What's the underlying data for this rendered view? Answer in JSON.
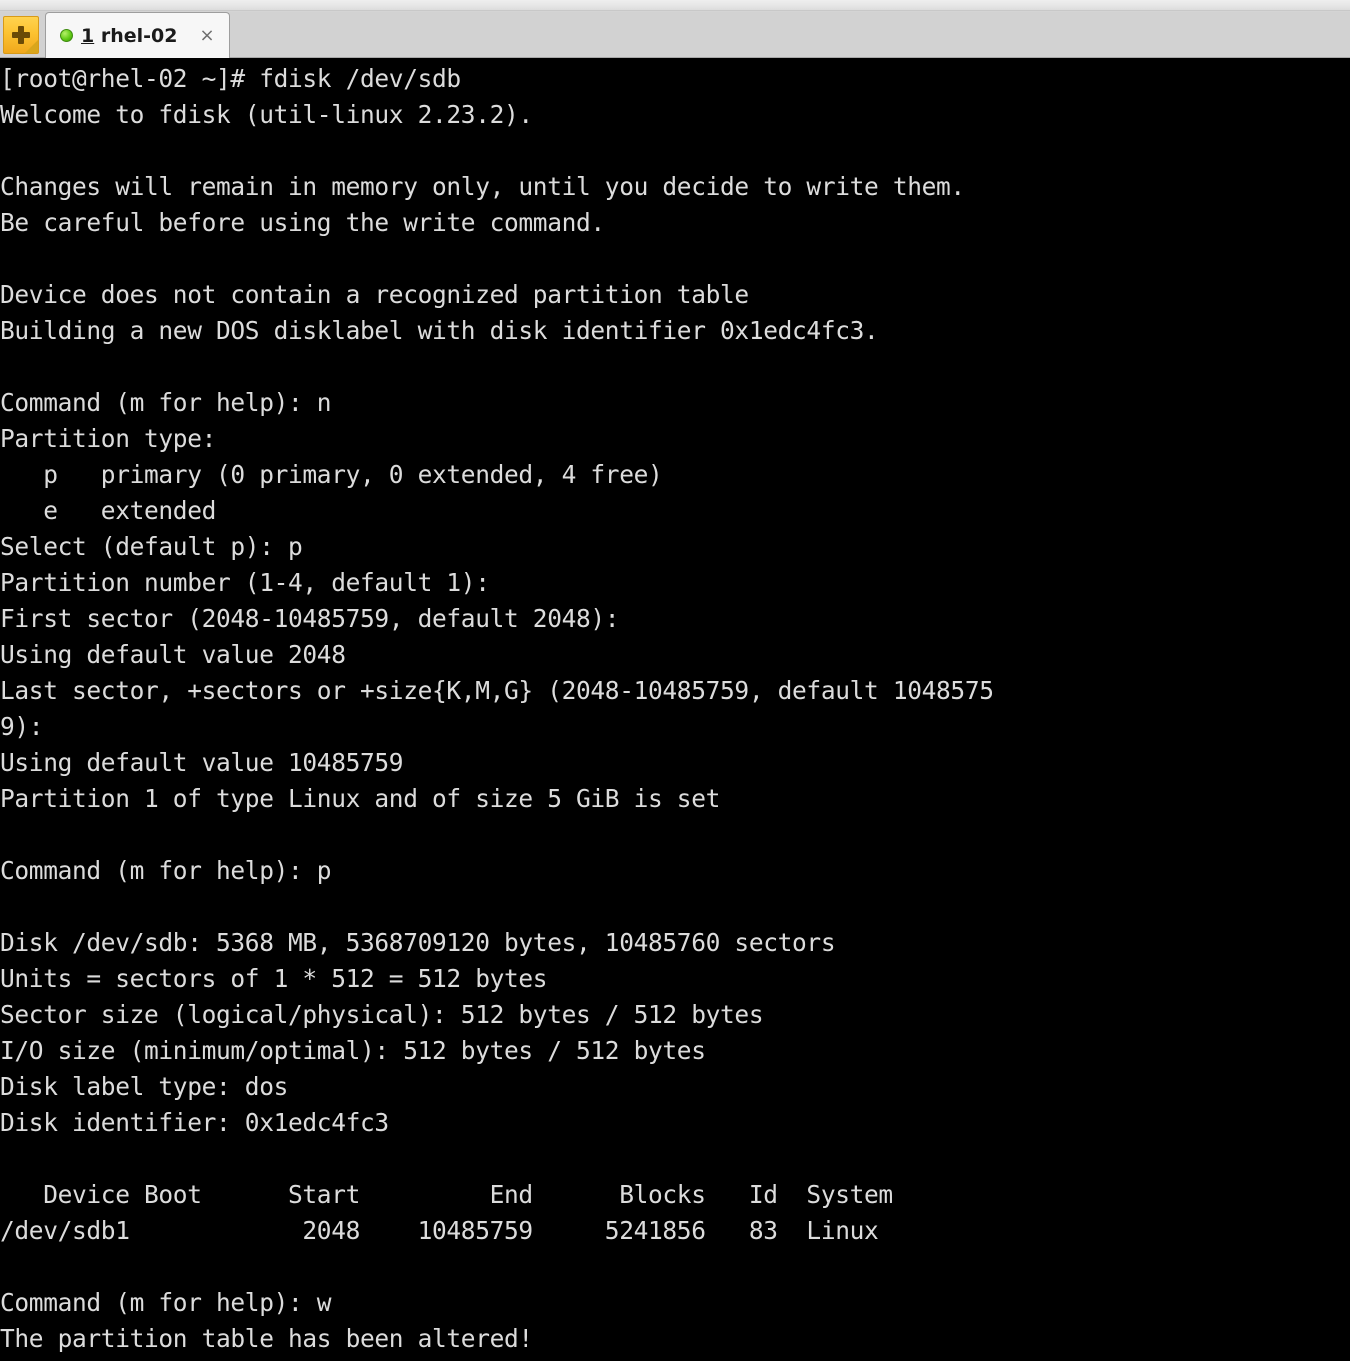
{
  "window": {
    "new_tab_button_label": "+",
    "tabs": [
      {
        "index": "1",
        "title": " rhel-02",
        "close_label": "×",
        "status": "connected",
        "active": true
      }
    ]
  },
  "terminal": {
    "hostname": "rhel-02",
    "user": "root",
    "prompt": "[root@rhel-02 ~]#",
    "colors": {
      "background": "#000000",
      "foreground": "#dcdcdc",
      "tab_bar": "#d2d2d2",
      "active_tab": "#f7f7f7",
      "status_dot": "#63cc17",
      "new_tab_button": "#fcc231"
    },
    "lines": [
      "[root@rhel-02 ~]# fdisk /dev/sdb",
      "Welcome to fdisk (util-linux 2.23.2).",
      "",
      "Changes will remain in memory only, until you decide to write them.",
      "Be careful before using the write command.",
      "",
      "Device does not contain a recognized partition table",
      "Building a new DOS disklabel with disk identifier 0x1edc4fc3.",
      "",
      "Command (m for help): n",
      "Partition type:",
      "   p   primary (0 primary, 0 extended, 4 free)",
      "   e   extended",
      "Select (default p): p",
      "Partition number (1-4, default 1):",
      "First sector (2048-10485759, default 2048):",
      "Using default value 2048",
      "Last sector, +sectors or +size{K,M,G} (2048-10485759, default 1048575",
      "9):",
      "Using default value 10485759",
      "Partition 1 of type Linux and of size 5 GiB is set",
      "",
      "Command (m for help): p",
      "",
      "Disk /dev/sdb: 5368 MB, 5368709120 bytes, 10485760 sectors",
      "Units = sectors of 1 * 512 = 512 bytes",
      "Sector size (logical/physical): 512 bytes / 512 bytes",
      "I/O size (minimum/optimal): 512 bytes / 512 bytes",
      "Disk label type: dos",
      "Disk identifier: 0x1edc4fc3",
      "",
      "   Device Boot      Start         End      Blocks   Id  System",
      "/dev/sdb1            2048    10485759     5241856   83  Linux",
      "",
      "Command (m for help): w",
      "The partition table has been altered!"
    ],
    "session": {
      "command": "fdisk /dev/sdb",
      "tool": "fdisk",
      "tool_version": "util-linux 2.23.2",
      "device": "/dev/sdb",
      "disk_identifier": "0x1edc4fc3",
      "disk_label_type": "dos",
      "disk_size_mb": "5368 MB",
      "disk_size_bytes": "5368709120 bytes",
      "disk_sectors": "10485760 sectors",
      "units": "sectors of 1 * 512 = 512 bytes",
      "sector_size_logical": "512 bytes",
      "sector_size_physical": "512 bytes",
      "io_size_minimum": "512 bytes",
      "io_size_optimal": "512 bytes",
      "first_sector_default": "2048",
      "last_sector_default": "10485759",
      "partition_size": "5 GiB",
      "partition_type": "Linux",
      "partition_number": "1",
      "table_headers": [
        "Device",
        "Boot",
        "Start",
        "End",
        "Blocks",
        "Id",
        "System"
      ],
      "table_rows": [
        {
          "device": "/dev/sdb1",
          "boot": "",
          "start": "2048",
          "end": "10485759",
          "blocks": "5241856",
          "id": "83",
          "system": "Linux"
        }
      ],
      "final_message": "The partition table has been altered!"
    }
  }
}
